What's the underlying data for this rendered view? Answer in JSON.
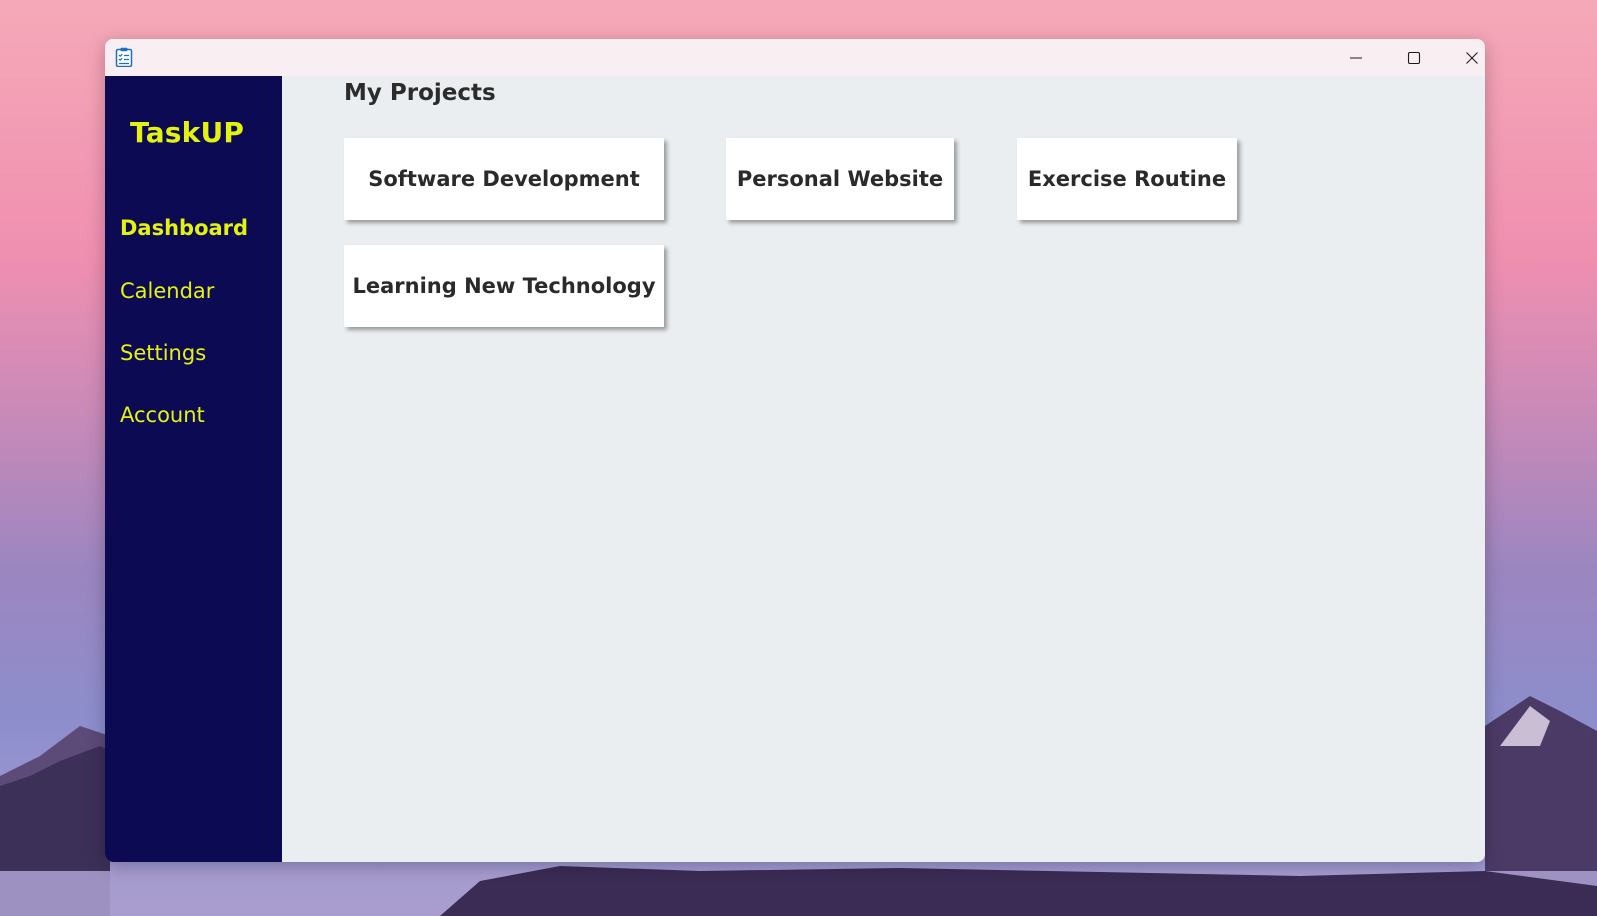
{
  "app": {
    "brand": "TaskUP",
    "icon": "clipboard-checklist-icon"
  },
  "window_controls": {
    "minimize_icon": "minimize-icon",
    "maximize_icon": "maximize-icon",
    "close_icon": "close-icon"
  },
  "sidebar": {
    "items": [
      {
        "label": "Dashboard",
        "active": true
      },
      {
        "label": "Calendar",
        "active": false
      },
      {
        "label": "Settings",
        "active": false
      },
      {
        "label": "Account",
        "active": false
      }
    ]
  },
  "main": {
    "title": "My Projects",
    "projects": [
      {
        "name": "Software Development"
      },
      {
        "name": "Personal Website"
      },
      {
        "name": "Exercise Routine"
      },
      {
        "name": "Learning New Technology"
      }
    ]
  },
  "colors": {
    "sidebar_bg": "#0d0a54",
    "accent_text": "#e4f20f",
    "main_bg": "#ebeef0",
    "card_bg": "#ffffff",
    "titlebar_bg": "#f9eef1"
  }
}
